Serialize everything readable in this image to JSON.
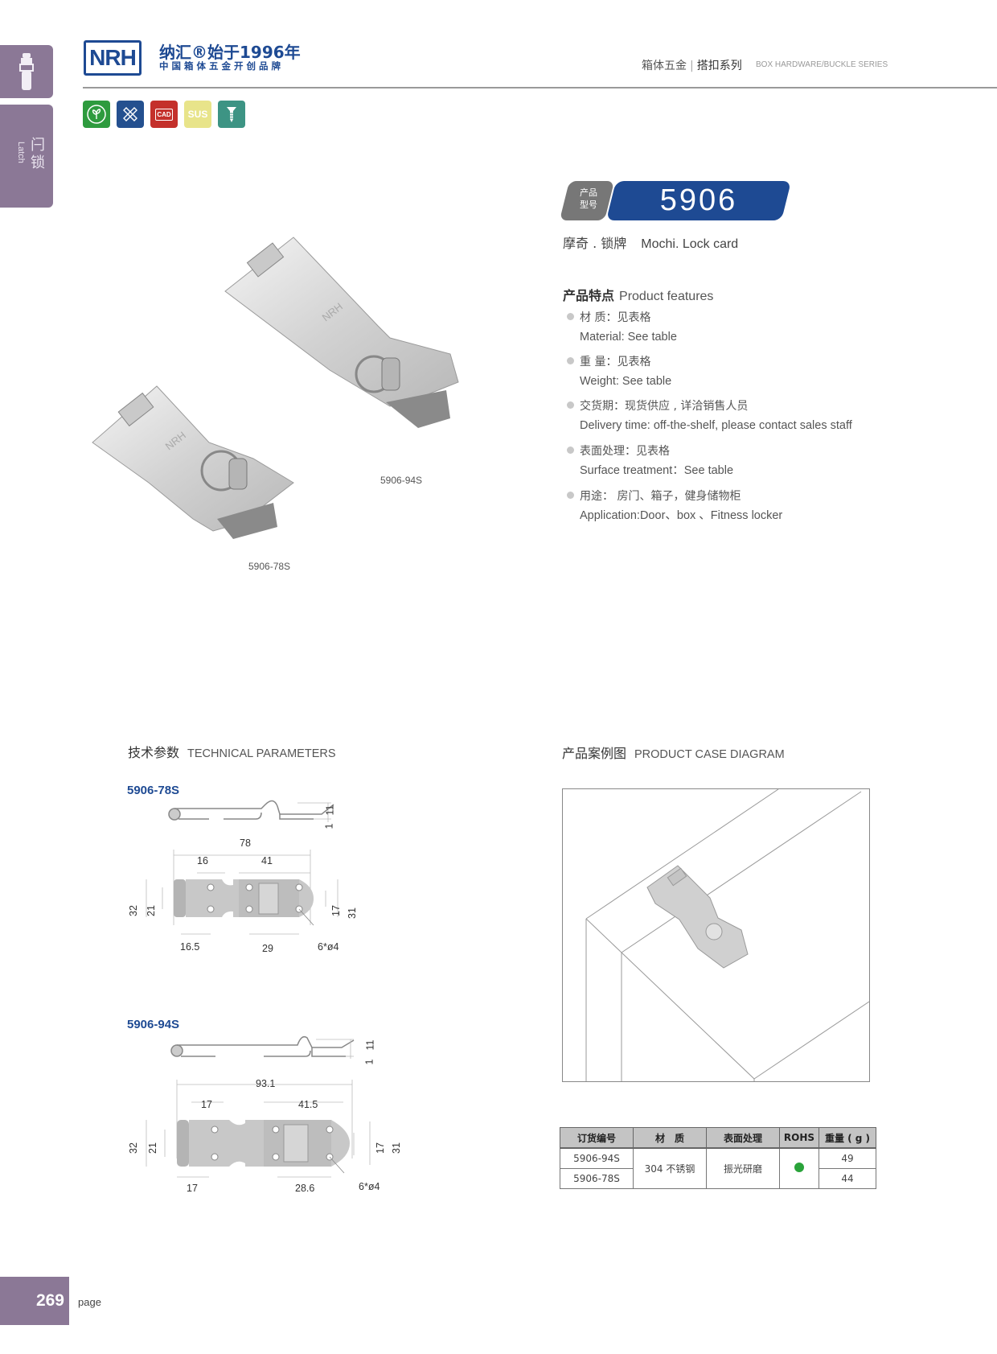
{
  "side_tab": {
    "cn": "闩锁",
    "en": "Latch",
    "icon": "latch-icon"
  },
  "brand": {
    "logo": "NRH",
    "line1": "纳汇®始于1996年",
    "line2": "中国箱体五金开创品牌"
  },
  "header": {
    "category_cn": "箱体五金",
    "series_cn": "搭扣系列",
    "series_en": "BOX HARDWARE/BUCKLE SERIES"
  },
  "badges": [
    {
      "name": "eco-icon",
      "label": "",
      "color": "#2e9b3e"
    },
    {
      "name": "tools-icon",
      "label": "",
      "color": "#24508f"
    },
    {
      "name": "cad-icon",
      "label": "CAD",
      "color": "#c4302b"
    },
    {
      "name": "sus-icon",
      "label": "SUS",
      "color": "#e8e48a"
    },
    {
      "name": "screw-icon",
      "label": "",
      "color": "#3d9484"
    }
  ],
  "product": {
    "tag_line1": "产品",
    "tag_line2": "型号",
    "number": "5906",
    "name_cn": "摩奇 . 锁牌",
    "name_en": "Mochi. Lock card"
  },
  "features": {
    "title_cn": "产品特点",
    "title_en": "Product features",
    "items": [
      {
        "cn": "材   质：见表格",
        "en": "Material: See table"
      },
      {
        "cn": "重   量：见表格",
        "en": " Weight: See table"
      },
      {
        "cn": "交货期：现货供应 , 详洽销售人员",
        "en": "Delivery time: off-the-shelf, please contact sales staff"
      },
      {
        "cn": "表面处理：见表格",
        "en": "Surface treatment：See table"
      },
      {
        "cn": "用途： 房门、箱子，健身储物柜",
        "en": "Application:Door、box 、Fitness locker"
      }
    ]
  },
  "photos": {
    "label_a": "5906-94S",
    "label_b": "5906-78S"
  },
  "tech": {
    "title_cn": "技术参数",
    "title_en": "TECHNICAL PARAMETERS",
    "models": [
      {
        "label": "5906-78S",
        "height": "11",
        "thickness": "1",
        "length": "78",
        "hinge_w": "16",
        "hasp_w": "41",
        "total_h": "32",
        "hole_pitch_l": "21",
        "hole_pitch_r": "17",
        "plate_h": "31",
        "hole_off": "16.5",
        "hole_span": "29",
        "holes": "6*ø4"
      },
      {
        "label": "5906-94S",
        "height": "11",
        "thickness": "1",
        "length": "93.1",
        "hinge_w": "17",
        "hasp_w": "41.5",
        "total_h": "32",
        "hole_pitch_l": "21",
        "hole_pitch_r": "17",
        "plate_h": "31",
        "hole_off": "17",
        "hole_span": "28.6",
        "holes": "6*ø4"
      }
    ]
  },
  "case": {
    "title_cn": "产品案例图",
    "title_en": "PRODUCT CASE DIAGRAM"
  },
  "table": {
    "headers": [
      "订货编号",
      "材　质",
      "表面处理",
      "ROHS",
      "重量 ( g )"
    ],
    "material": "304 不锈钢",
    "finish": "振光研磨",
    "rohs": "compliant",
    "rows": [
      {
        "code": "5906-94S",
        "weight": "49"
      },
      {
        "code": "5906-78S",
        "weight": "44"
      }
    ]
  },
  "footer": {
    "page": "269",
    "word": "page"
  }
}
